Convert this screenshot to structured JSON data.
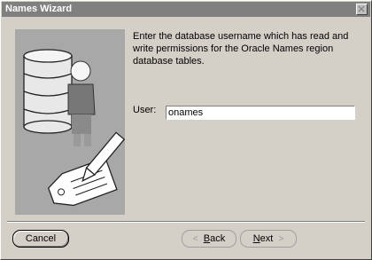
{
  "window": {
    "title": "Names Wizard"
  },
  "illustration": {
    "icon": "database-user-tag-icon"
  },
  "content": {
    "instruction": "Enter the database username which has read and write permissions for the Oracle Names region database tables.",
    "user_label": "User:",
    "user_value": "onames"
  },
  "buttons": {
    "cancel": "Cancel",
    "back_first": "B",
    "back_rest": "ack",
    "next_first": "N",
    "next_rest": "ext",
    "back_chevron": "<",
    "next_chevron": ">"
  }
}
